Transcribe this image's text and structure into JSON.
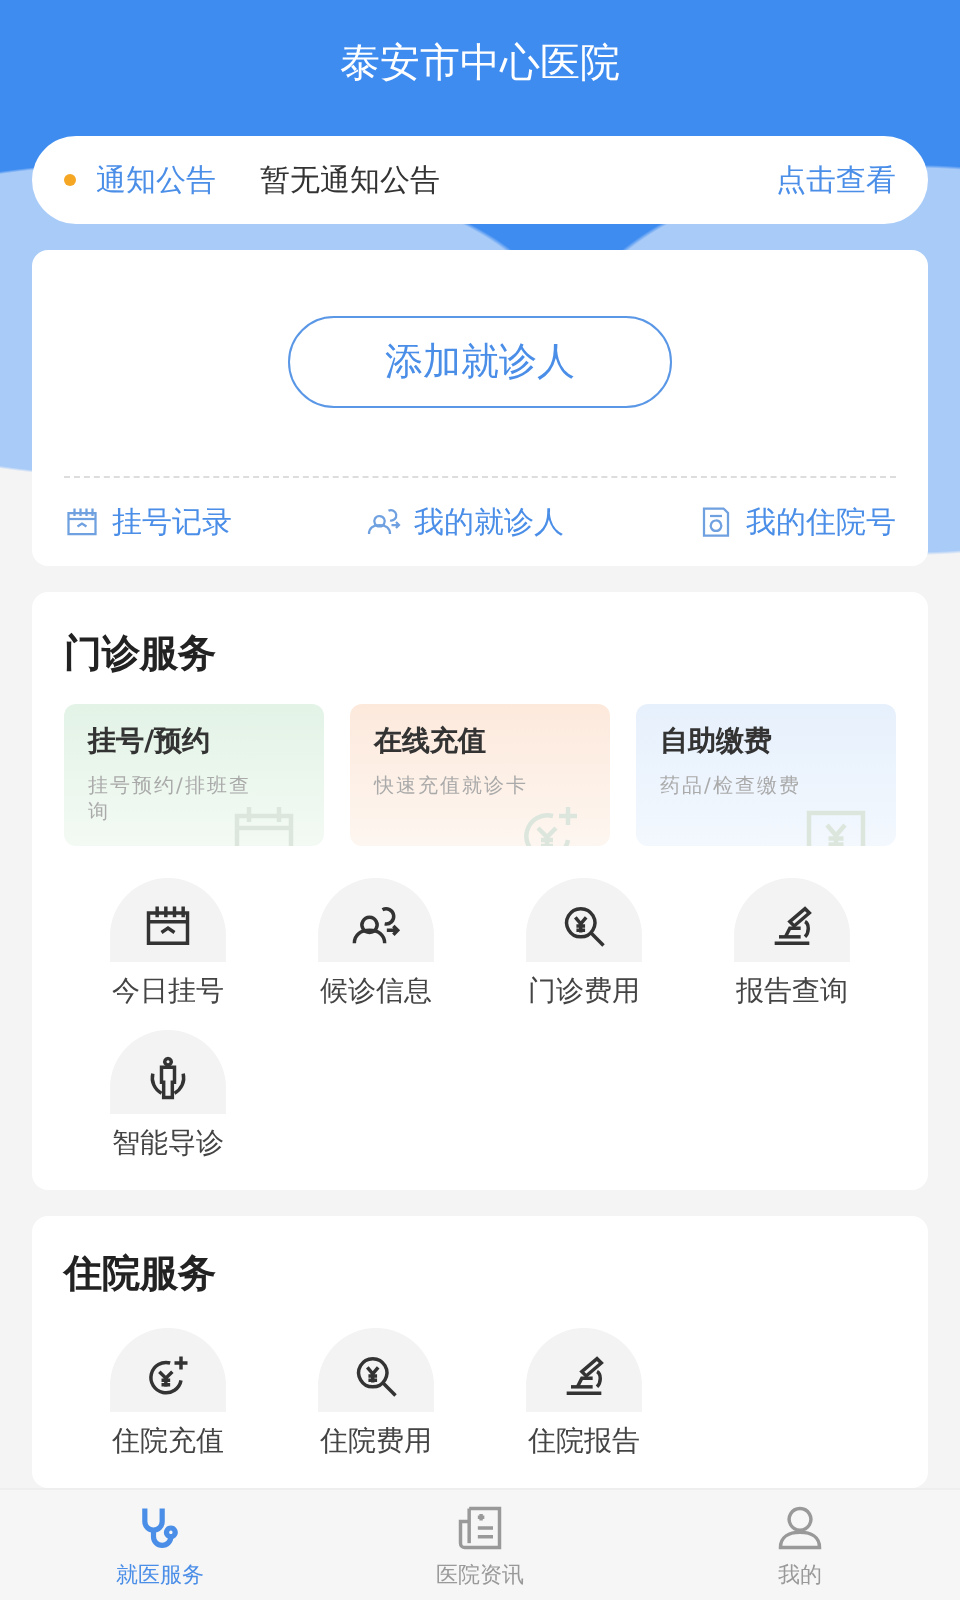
{
  "header": {
    "title": "泰安市中心医院"
  },
  "notice": {
    "label": "通知公告",
    "text": "暂无通知公告",
    "link": "点击查看"
  },
  "patient_card": {
    "add_button": "添加就诊人",
    "links": [
      {
        "label": "挂号记录",
        "kind": "calendar"
      },
      {
        "label": "我的就诊人",
        "kind": "people"
      },
      {
        "label": "我的住院号",
        "kind": "document"
      }
    ]
  },
  "outpatient": {
    "title": "门诊服务",
    "tiles": [
      {
        "title": "挂号/预约",
        "subtitle": "挂号预约/排班查询",
        "kind": "register"
      },
      {
        "title": "在线充值",
        "subtitle": "快速充值就诊卡",
        "kind": "recharge"
      },
      {
        "title": "自助缴费",
        "subtitle": "药品/检查缴费",
        "kind": "payment"
      }
    ],
    "items": [
      {
        "label": "今日挂号",
        "kind": "calendar"
      },
      {
        "label": "候诊信息",
        "kind": "people"
      },
      {
        "label": "门诊费用",
        "kind": "fee"
      },
      {
        "label": "报告查询",
        "kind": "microscope"
      },
      {
        "label": "智能导诊",
        "kind": "guide"
      }
    ]
  },
  "inpatient": {
    "title": "住院服务",
    "items": [
      {
        "label": "住院充值",
        "kind": "recharge"
      },
      {
        "label": "住院费用",
        "kind": "fee"
      },
      {
        "label": "住院报告",
        "kind": "microscope"
      }
    ]
  },
  "tab_bar": [
    {
      "label": "就医服务",
      "kind": "stethoscope",
      "selected": true
    },
    {
      "label": "医院资讯",
      "kind": "news",
      "selected": false
    },
    {
      "label": "我的",
      "kind": "user",
      "selected": false
    }
  ]
}
